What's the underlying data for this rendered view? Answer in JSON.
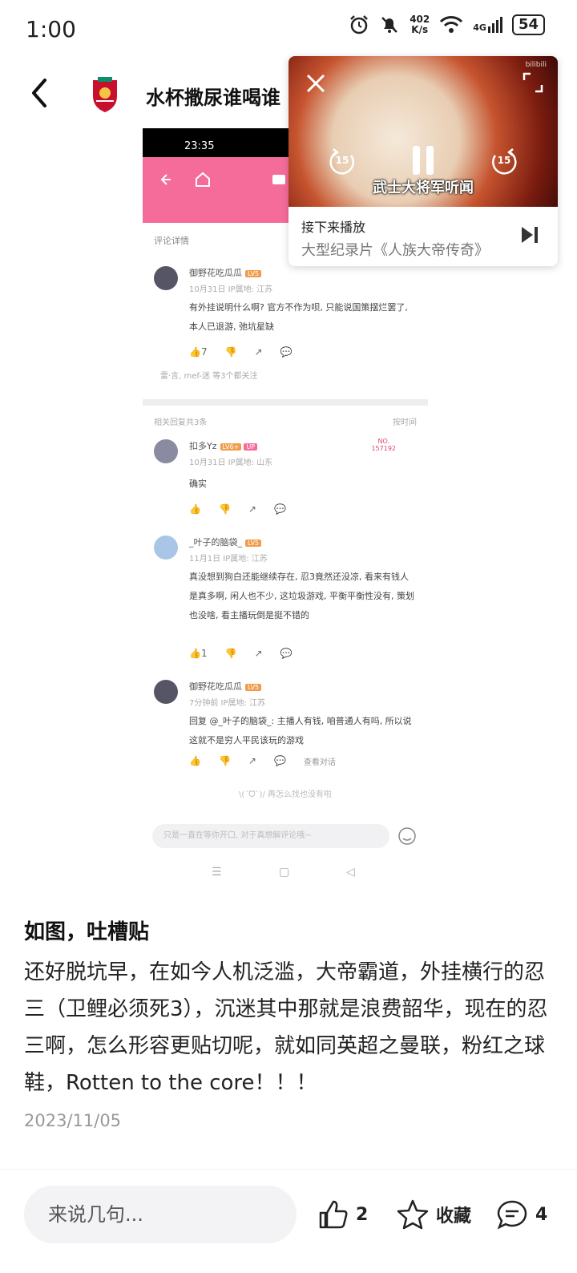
{
  "status_bar": {
    "time": "1:00",
    "net_speed_value": "402",
    "net_speed_unit": "K/s",
    "network": "4G",
    "battery": "54"
  },
  "header": {
    "title": "水杯撒尿谁喝谁"
  },
  "embedded_screenshot": {
    "time": "23:35",
    "section_title": "评论详情",
    "comment1": {
      "user": "御野花吃瓜瓜",
      "level": "LV5",
      "meta": "10月31日 IP属地: 江苏",
      "text": "有外挂说明什么啊? 官方不作为呗, 只能说国策摆烂罢了, 本人已退游, 弛坑星缺",
      "likes": "7",
      "reply_summary": "雷·言, mef-迷 等3个都关注"
    },
    "sort_label": "相关回复共3条",
    "sort_option": "按时间",
    "reply1": {
      "user": "扣多Yz",
      "level": "LV6+",
      "badge": "UP",
      "meta": "10月31日 IP属地: 山东",
      "text": "确实",
      "no_label": "NO.",
      "no_value": "157192"
    },
    "reply2": {
      "user": "_叶子的脑袋_",
      "level": "LV5",
      "meta": "11月1日 IP属地: 江苏",
      "text": "真没想到狗白还能继续存在, 忍3竟然还没凉, 看来有钱人是真多啊, 闲人也不少, 这垃圾游戏, 平衡平衡性没有, 策划也没啥, 看主播玩倒是挺不错的",
      "likes": "1"
    },
    "reply3": {
      "user": "御野花吃瓜瓜",
      "level": "LV5",
      "meta": "7分钟前 IP属地: 江苏",
      "text": "回复 @_叶子的脑袋_: 主播人有钱, 咱普通人有吗, 所以说这就不是穷人平民该玩的游戏",
      "view_dialog": "查看对话"
    },
    "end_text": "\\(ˊᗜˋ)/ 再怎么找也没有啦",
    "input_placeholder": "只是一直在等你开口, 对于真想解评论哦~"
  },
  "floating_video": {
    "caption": "武士大将军听闻",
    "rewind_seconds": "15",
    "forward_seconds": "15",
    "watermark": "bilibili",
    "next_label": "接下来播放",
    "next_title": "大型纪录片《人族大帝传奇》"
  },
  "post": {
    "heading": "如图，吐槽贴",
    "body": "还好脱坑早，在如今人机泛滥，大帝霸道，外挂横行的忍三（卫鲤必须死3），沉迷其中那就是浪费韶华，现在的忍三啊，怎么形容更贴切呢，就如同英超之曼联，粉红之球鞋，Rotten to the core！！！",
    "date": "2023/11/05"
  },
  "bottom_bar": {
    "input_placeholder": "来说几句...",
    "like_count": "2",
    "favorite_label": "收藏",
    "comment_count": "4"
  }
}
